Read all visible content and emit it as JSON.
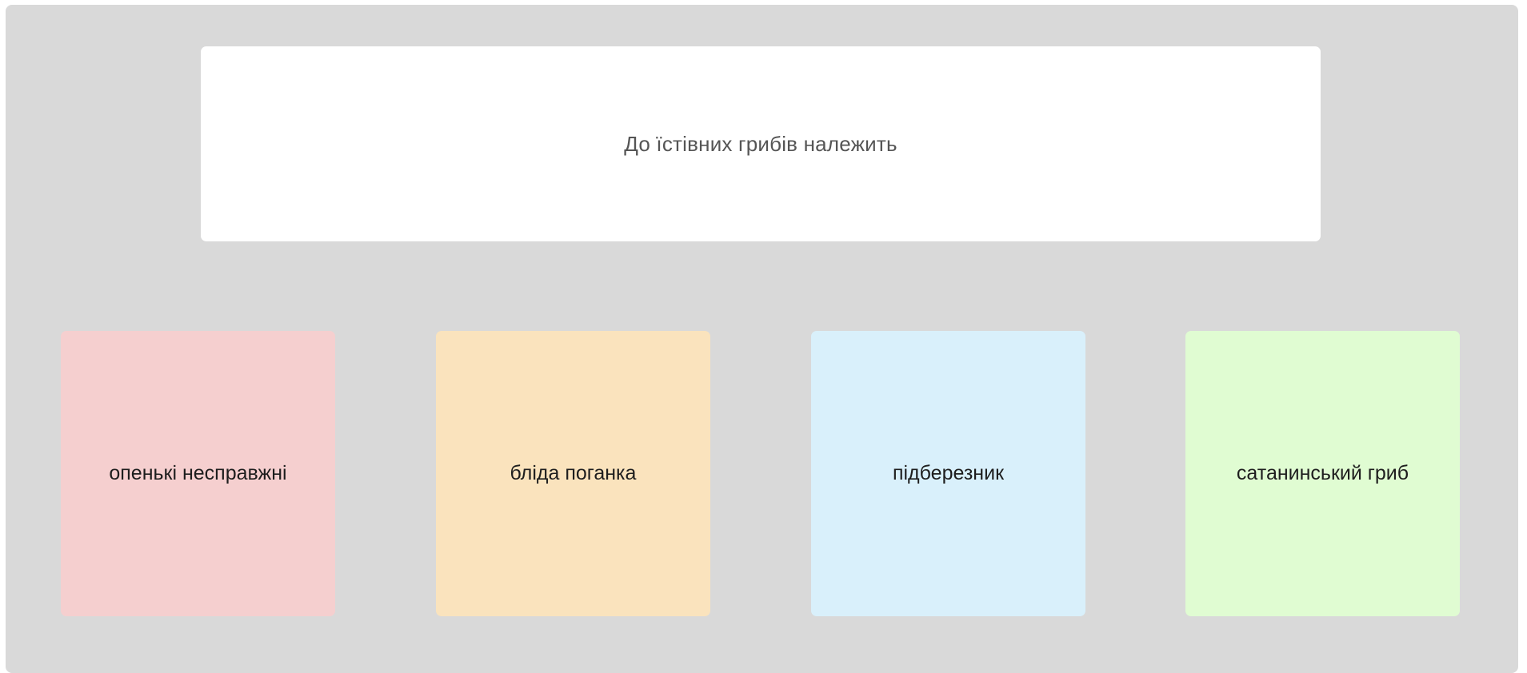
{
  "question": {
    "text": "До їстівних грибів належить"
  },
  "answers": [
    {
      "label": "опенькі несправжні",
      "color": "#f5cfcf"
    },
    {
      "label": "бліда поганка",
      "color": "#fae3bd"
    },
    {
      "label": "підберезник",
      "color": "#d9f0fb"
    },
    {
      "label": "сатанинський гриб",
      "color": "#e0fcd2"
    }
  ],
  "colors": {
    "panel_background": "#d9d9d9",
    "question_background": "#ffffff",
    "question_text": "#555555",
    "answer_text": "#1e1e1e"
  }
}
